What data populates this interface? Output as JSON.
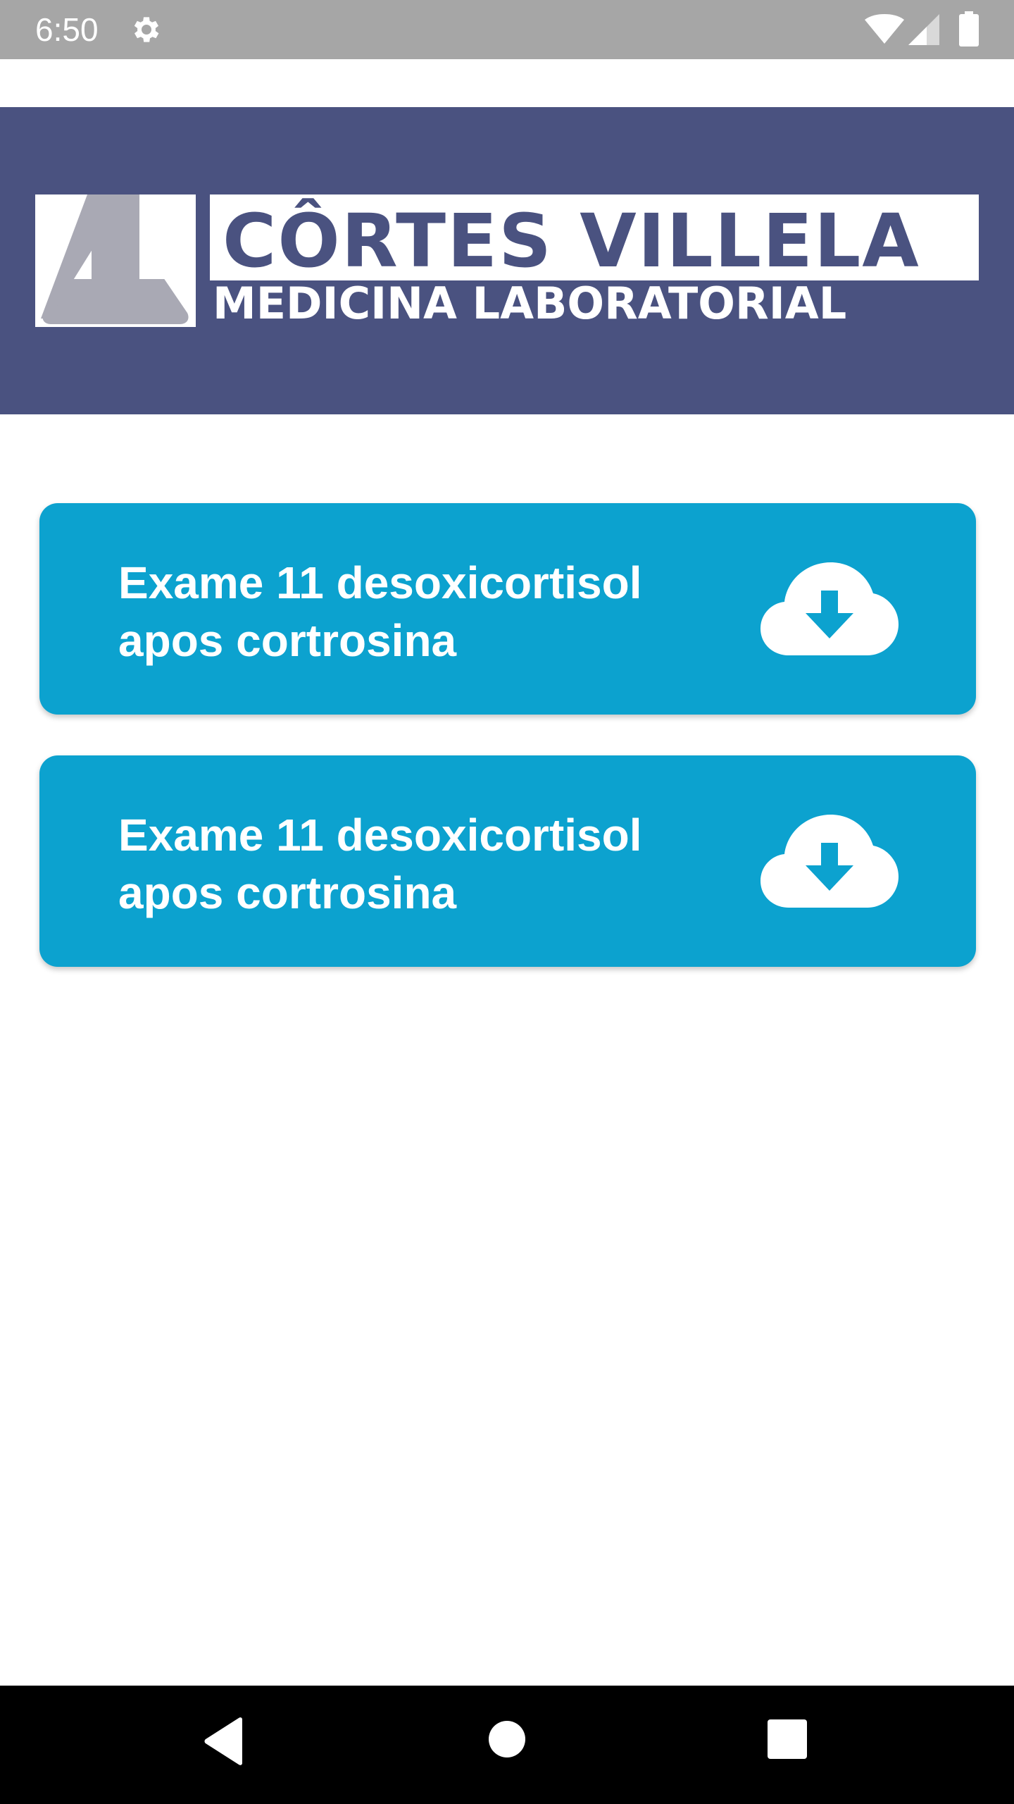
{
  "status_bar": {
    "time": "6:50",
    "icons": [
      "gear-icon",
      "wifi-icon",
      "cell-signal-icon",
      "battery-icon"
    ]
  },
  "header": {
    "logo_name": "CÔRTES VILLELA",
    "logo_subtitle": "MEDICINA LABORATORIAL",
    "background_color": "#4a5280"
  },
  "exams": [
    {
      "title": "Exame 11 desoxicortisol apos cortrosina",
      "icon": "cloud-download-icon"
    },
    {
      "title": "Exame 11 desoxicortisol apos cortrosina",
      "icon": "cloud-download-icon"
    }
  ],
  "colors": {
    "card": "#0ca2cf",
    "status_bar": "#a6a6a6",
    "nav_bar": "#000000"
  },
  "nav_bar": {
    "icons": [
      "back-icon",
      "home-icon",
      "recents-icon"
    ]
  }
}
